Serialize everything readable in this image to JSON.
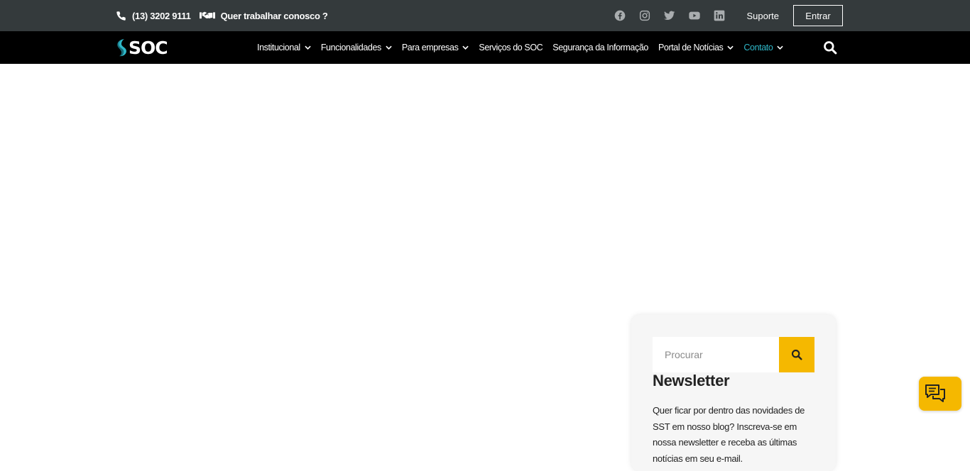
{
  "topbar": {
    "phone": "(13) 3202 9111",
    "work_with_us": "Quer trabalhar conosco ?",
    "social_icons": [
      "facebook-icon",
      "instagram-icon",
      "twitter-icon",
      "youtube-icon",
      "linkedin-icon"
    ],
    "support_label": "Suporte",
    "enter_label": "Entrar"
  },
  "brand": {
    "logo_text": "SOC",
    "accent_color": "#2fb7c8",
    "highlight_color": "#f5b800"
  },
  "nav": {
    "items": [
      {
        "label": "Institucional",
        "has_dropdown": true
      },
      {
        "label": "Funcionalidades",
        "has_dropdown": true
      },
      {
        "label": "Para empresas",
        "has_dropdown": true
      },
      {
        "label": "Serviços do SOC",
        "has_dropdown": false
      },
      {
        "label": "Segurança da Informação",
        "has_dropdown": false
      },
      {
        "label": "Portal de Notícias",
        "has_dropdown": true
      },
      {
        "label": "Contato",
        "has_dropdown": true,
        "active": true
      }
    ]
  },
  "sidebar": {
    "search_placeholder": "Procurar",
    "newsletter_title": "Newsletter",
    "newsletter_text": "Quer ficar por dentro das novidades de SST em nosso blog? Inscreva-se em nossa newsletter e receba as últimas notícias em seu e-mail."
  }
}
